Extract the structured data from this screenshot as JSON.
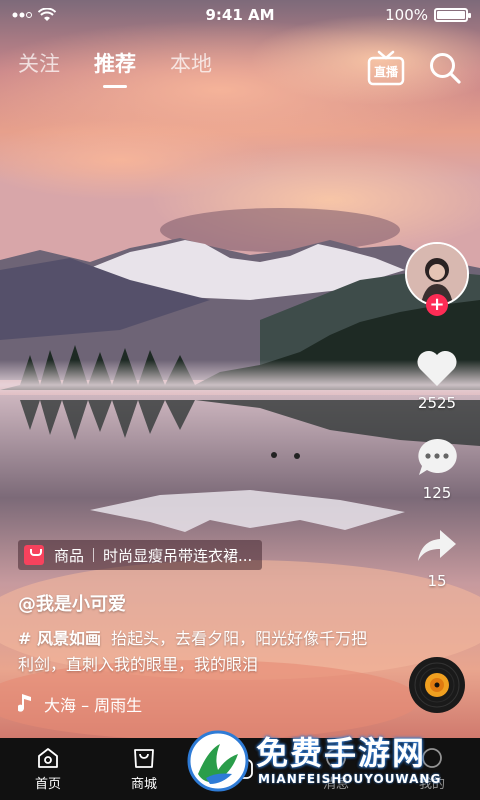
{
  "status_bar": {
    "time": "9:41 AM",
    "battery": "100%"
  },
  "top_tabs": [
    {
      "label": "关注",
      "active": false
    },
    {
      "label": "推荐",
      "active": true
    },
    {
      "label": "本地",
      "active": false
    }
  ],
  "live_label": "直播",
  "actions": {
    "likes": "2525",
    "comments": "125",
    "shares": "15"
  },
  "product": {
    "label": "商品",
    "title": "时尚显瘦吊带连衣裙..."
  },
  "username": "@我是小可爱",
  "caption": {
    "tag": "# 风景如画",
    "text": "抬起头，去看夕阳，阳光好像千万把利剑，直刺入我的眼里，我的眼泪"
  },
  "music": "大海 – 周雨生",
  "bottom_nav": [
    {
      "label": "首页",
      "icon": "home-icon"
    },
    {
      "label": "商城",
      "icon": "shop-icon"
    },
    {
      "label": "",
      "icon": "create-icon"
    },
    {
      "label": "消息",
      "icon": "message-icon"
    },
    {
      "label": "我的",
      "icon": "profile-icon"
    }
  ],
  "watermark": {
    "title": "免费手游网",
    "subtitle": "MIANFEISHOUYOUWANG"
  },
  "colors": {
    "accent": "#fe2c55",
    "nav_bg": "#111111"
  }
}
